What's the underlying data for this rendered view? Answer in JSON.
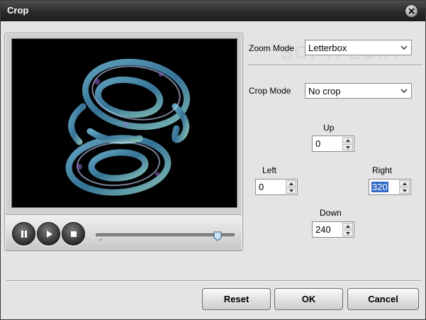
{
  "window": {
    "title": "Crop"
  },
  "zoom": {
    "label": "Zoom Mode",
    "value": "Letterbox"
  },
  "crop": {
    "label": "Crop Mode",
    "value": "No crop"
  },
  "margins": {
    "up": {
      "label": "Up",
      "value": "0"
    },
    "left": {
      "label": "Left",
      "value": "0"
    },
    "right": {
      "label": "Right",
      "value": "320"
    },
    "down": {
      "label": "Down",
      "value": "240"
    }
  },
  "player": {
    "seek_progress": 0.88
  },
  "buttons": {
    "reset": "Reset",
    "ok": "OK",
    "cancel": "Cancel"
  },
  "watermark": "SOFTPEDIA",
  "colors": {
    "titlebar": "#2a2a2a",
    "selection": "#3169c6",
    "video_bg": "#000000"
  },
  "icons": [
    "close-icon",
    "pause-icon",
    "play-icon",
    "stop-icon",
    "chevron-down-icon",
    "arrow-up-icon",
    "arrow-down-icon"
  ]
}
